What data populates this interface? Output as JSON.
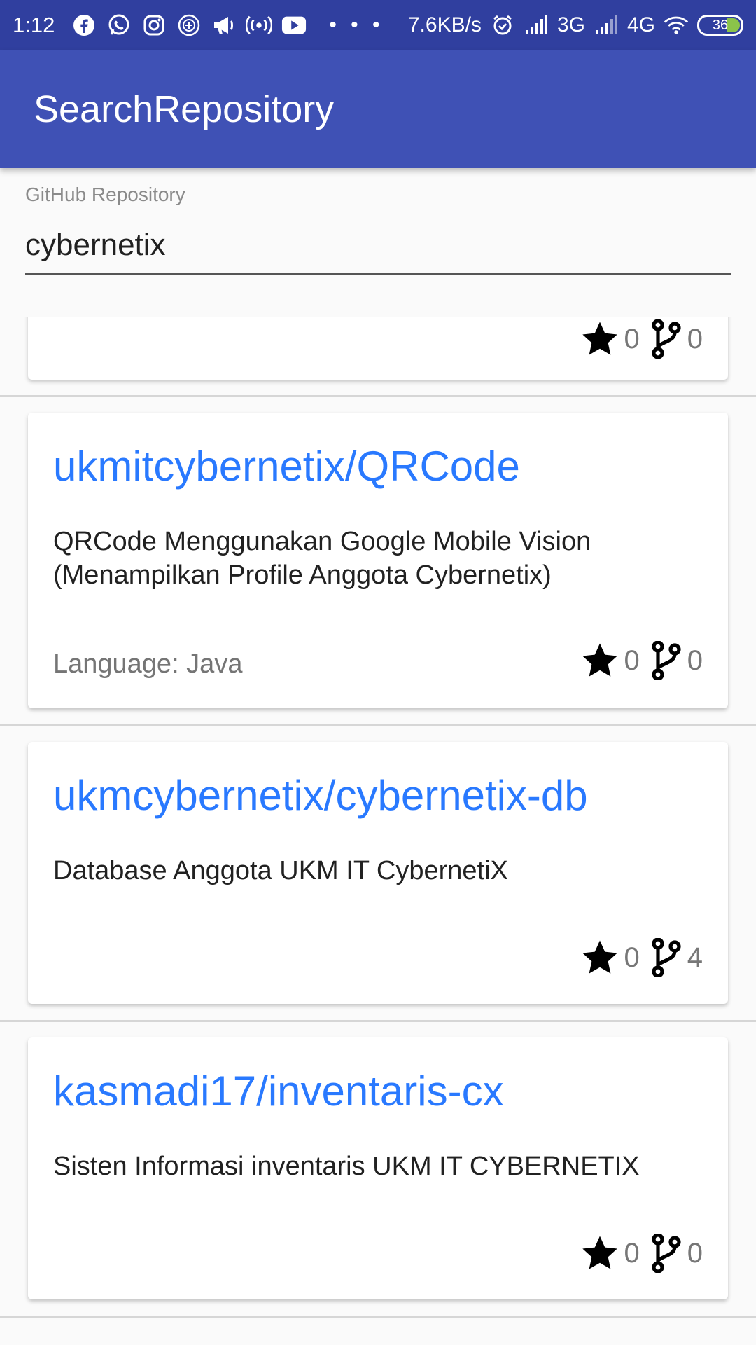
{
  "status_bar": {
    "time": "1:12",
    "network_speed": "7.6KB/s",
    "network_1": "3G",
    "network_2": "4G",
    "battery": "36"
  },
  "app_bar": {
    "title": "SearchRepository"
  },
  "search": {
    "label": "GitHub Repository",
    "value": "cybernetix"
  },
  "partial_card": {
    "stars": "0",
    "forks": "0"
  },
  "repos": [
    {
      "name": "ukmitcybernetix/QRCode",
      "description": "QRCode Menggunakan Google Mobile  Vision (Menampilkan Profile Anggota Cybernetix)",
      "language": "Language: Java",
      "stars": "0",
      "forks": "0"
    },
    {
      "name": "ukmcybernetix/cybernetix-db",
      "description": "Database Anggota UKM IT CybernetiX",
      "language": "",
      "stars": "0",
      "forks": "4"
    },
    {
      "name": "kasmadi17/inventaris-cx",
      "description": "Sisten Informasi inventaris UKM IT CYBERNETIX",
      "language": "",
      "stars": "0",
      "forks": "0"
    }
  ],
  "icons": {
    "star": "star-icon",
    "fork": "fork-icon"
  },
  "colors": {
    "status_bar": "#303f9f",
    "app_bar": "#3f51b5",
    "repo_title": "#2979ff"
  }
}
